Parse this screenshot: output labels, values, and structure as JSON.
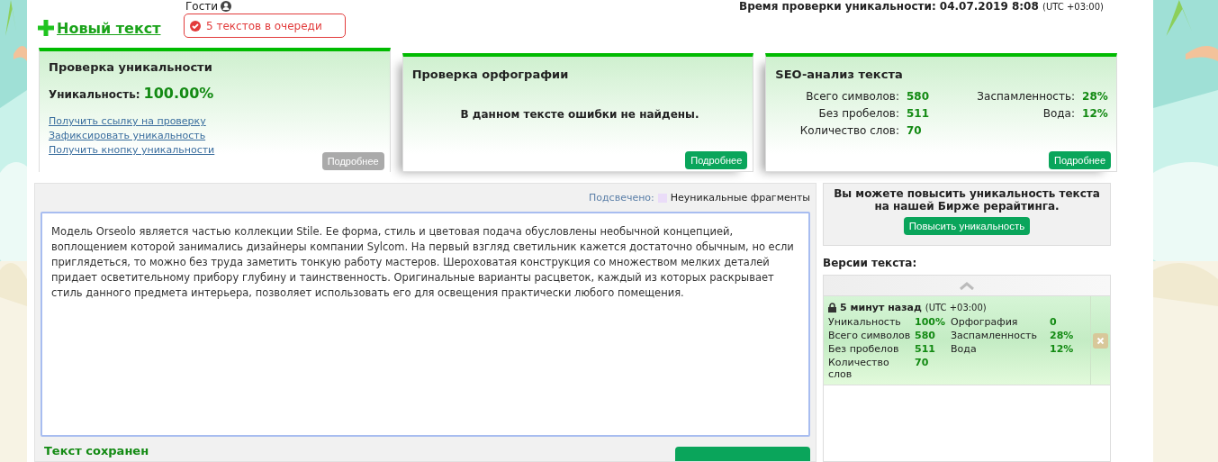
{
  "header": {
    "guest_label": "Гости",
    "new_text_link": "Новый текст",
    "queue_status": "5 текстов в очереди",
    "check_time_label": "Время проверки уникальности: 04.07.2019 8:08",
    "check_time_zone": "(UTC +03:00)"
  },
  "cards": [
    {
      "kind": "uniqueness",
      "selected": true,
      "title": "Проверка уникальности",
      "label": "Уникальность:",
      "value": "100.00%",
      "links": [
        "Получить ссылку на проверку",
        "Зафиксировать уникальность",
        "Получить кнопку уникальности"
      ],
      "button": {
        "label": "Подробнее",
        "disabled": true
      }
    },
    {
      "kind": "spelling",
      "selected": false,
      "title": "Проверка орфографии",
      "message": "В данном тексте ошибки не найдены.",
      "button": {
        "label": "Подробнее",
        "disabled": false
      }
    },
    {
      "kind": "seo",
      "selected": false,
      "title": "SEO-анализ текста",
      "stats_left": [
        {
          "label": "Всего символов:",
          "value": "580"
        },
        {
          "label": "Без пробелов:",
          "value": "511"
        },
        {
          "label": "Количество слов:",
          "value": "70"
        }
      ],
      "stats_right": [
        {
          "label": "Заспамленность:",
          "value": "28%"
        },
        {
          "label": "Вода:",
          "value": "12%"
        }
      ],
      "button": {
        "label": "Подробнее",
        "disabled": false
      }
    }
  ],
  "editor": {
    "legend_label": "Подсвечено:",
    "legend_text": "Неуникальные фрагменты",
    "text": "Модель Orseolo является частью коллекции Stile. Ее форма, стиль и цветовая подача обусловлены необычной концепцией, воплощением которой занимались дизайнеры компании Sylcom. На первый взгляд светильник кажется достаточно обычным, но если приглядеться, то можно без труда заметить тонкую работу мастеров. Шероховатая конструкция со множеством мелких деталей придает осветительному прибору глубину и таинственность. Оригинальные варианты расцветок, каждый из которых раскрывает стиль данного предмета интерьера, позволяет использовать его для освещения практически любого помещения.",
    "status": "Текст сохранен"
  },
  "promo": {
    "message": "Вы можете повысить уникальность текста на нашей Бирже рерайтинга.",
    "button": "Повысить уникальность"
  },
  "versions": {
    "title": "Версии текста:",
    "items": [
      {
        "locked": true,
        "time": "5 минут назад",
        "zone": "(UTC +03:00)",
        "stats_left": [
          {
            "label": "Уникальность",
            "value": "100%"
          },
          {
            "label": "Всего символов",
            "value": "580"
          },
          {
            "label": "Без пробелов",
            "value": "511"
          },
          {
            "label": "Количество слов",
            "value": "70"
          }
        ],
        "stats_right": [
          {
            "label": "Орфография",
            "value": "0"
          },
          {
            "label": "Заспамленность",
            "value": "28%"
          },
          {
            "label": "Вода",
            "value": "12%"
          }
        ]
      }
    ]
  }
}
